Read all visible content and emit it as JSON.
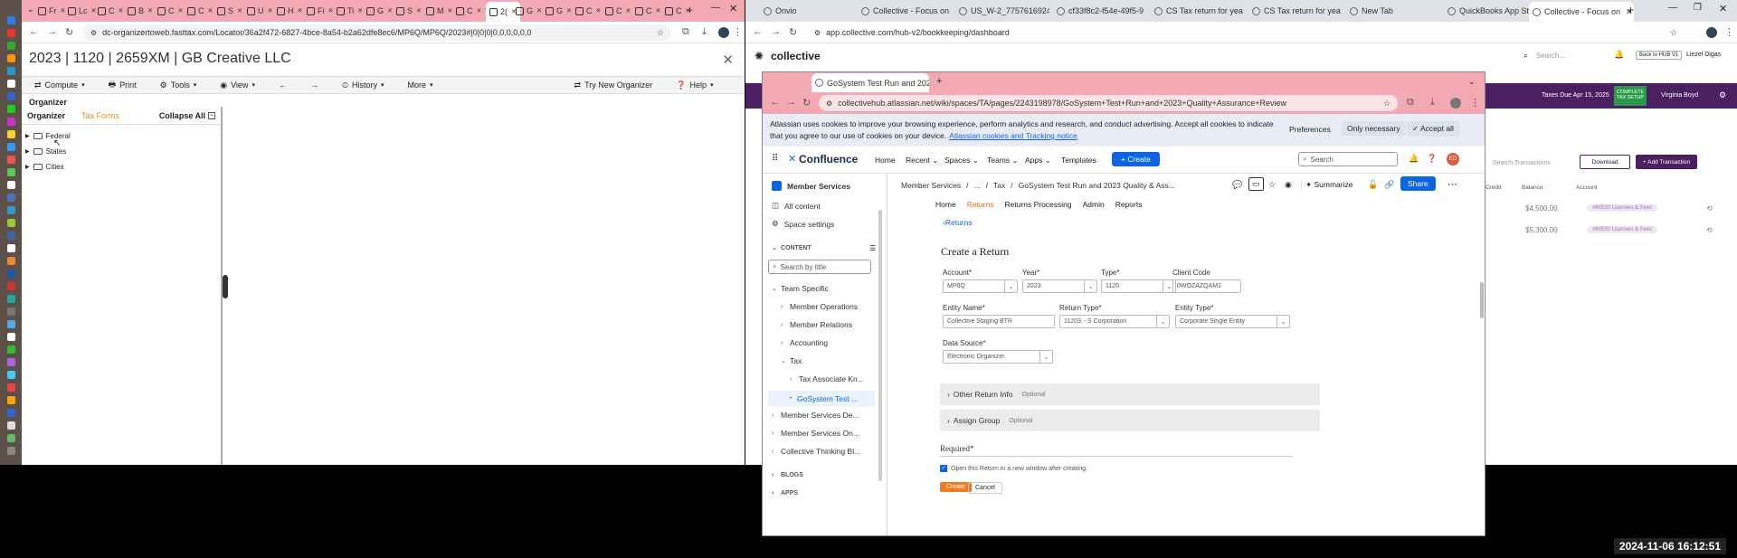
{
  "left_window": {
    "url": "dc-organizertoweb.fasttax.com/Locator/36a2f472-6827-4bce-8a54-b2a62dfe8ec6/MP6Q/MP6Q/2023#|0|0|0|0,0,0,0,0,0",
    "tab_labels": [
      "Fr",
      "Lc",
      "C",
      "B",
      "C",
      "C",
      "S",
      "U",
      "H",
      "Fi",
      "Ti",
      "G",
      "S",
      "M",
      "C",
      "2(",
      "G",
      "G",
      "C",
      "C",
      "C",
      "C"
    ],
    "organizer_title": "2023 | 1120 | 2659XM | GB Creative LLC",
    "close_glyph": "✕",
    "toolbar": {
      "compute": "Compute",
      "print": "Print",
      "tools": "Tools",
      "view": "View",
      "history": "History",
      "more": "More",
      "try_new": "Try New Organizer",
      "help": "Help"
    },
    "section_label": "Organizer",
    "pane_tab_organizer": "Organizer",
    "pane_tab_taxforms": "Tax Forms",
    "collapse_all": "Collapse All",
    "tree": [
      "Federal",
      "States",
      "Cities"
    ]
  },
  "right_window": {
    "tabs": [
      "Onvio",
      "Collective - Focus on",
      "US_W-2_7757616924",
      "cf33f8c2-f54e-49f5-9",
      "CS Tax return for yea",
      "CS Tax return for yea",
      "New Tab",
      "QuickBooks App Sto",
      "Collective - Focus on"
    ],
    "url": "app.collective.com/hub-v2/bookkeeping/dashboard",
    "logo_text": "collective",
    "search_placeholder": "Search...",
    "back_to_hub": "Back to HUB V1",
    "user_name": "Liezel Digas",
    "taxes_due": "Taxes Due Apr 15, 2025",
    "complete_tax_setup": "COMPLETE TAX SETUP",
    "user2": "Virginia Boyd",
    "search_tx_placeholder": "Search Transactions",
    "download": "Download",
    "add_transaction": "+ Add Transaction",
    "col_credit": "Credit",
    "col_balance": "Balance",
    "col_account": "Account",
    "rows": [
      {
        "balance": "$4,500.00",
        "account": "#60530 Licenses & Fees"
      },
      {
        "balance": "$5,300.00",
        "account": "#60530 Licenses & Fees"
      }
    ]
  },
  "popup": {
    "tab": "GoSystem Test Run and 2023",
    "url": "collectivehub.atlassian.net/wiki/spaces/TA/pages/2243198978/GoSystem+Test+Run+and+2023+Quality+Assurance+Review",
    "cookie_line1": "Atlassian uses cookies to improve your browsing experience, perform analytics and research, and conduct advertising. Accept all cookies to indicate",
    "cookie_line2": "that you agree to our use of cookies on your device.",
    "cookie_link": "Atlassian cookies and Tracking notice",
    "preferences": "Preferences",
    "only_necessary": "Only necessary",
    "accept_all": "Accept all",
    "nav": {
      "logo": "Confluence",
      "home": "Home",
      "recent": "Recent",
      "spaces": "Spaces",
      "teams": "Teams",
      "apps": "Apps",
      "templates": "Templates",
      "create": "+ Create",
      "search": "Search",
      "avatar": "ED"
    },
    "sidebar": {
      "space": "Member Services",
      "all_content": "All content",
      "space_settings": "Space settings",
      "content": "CONTENT",
      "search_placeholder": "Search by title",
      "items": [
        "Team Specific",
        "Member Operations",
        "Member Relations",
        "Accounting",
        "Tax",
        "Tax Associate Kn...",
        "GoSystem Test ...",
        "Member Services De...",
        "Member Services On...",
        "Collective Thinking Bl..."
      ],
      "blogs": "BLOGS",
      "apps": "APPS"
    },
    "breadcrumb": {
      "space": "Member Services",
      "sep1": "/",
      "ellipsis": "...",
      "sep2": "/",
      "tax": "Tax",
      "sep3": "/",
      "page": "GoSystem Test Run and 2023 Quality & Ass..."
    },
    "summarize": "Summarize",
    "share": "Share",
    "page_nav": {
      "home": "Home",
      "returns": "Returns",
      "returns_processing": "Returns Processing",
      "admin": "Admin",
      "reports": "Reports"
    },
    "back_returns": "Returns",
    "form": {
      "title": "Create a Return",
      "account_label": "Account*",
      "account": "MP6Q",
      "year_label": "Year*",
      "year": "2023",
      "type_label": "Type*",
      "type": "1120",
      "client_code_label": "Client Code",
      "client_code": "0WOZAZQAM1",
      "entity_name_label": "Entity Name*",
      "entity_name": "Collective Staging BTR",
      "return_type_label": "Return Type*",
      "return_type": "1120S - S Corporation",
      "entity_type_label": "Entity Type*",
      "entity_type": "Corporate Single Entity",
      "data_source_label": "Data Source*",
      "data_source": "Electronic Organizer",
      "other_info": "Other Return Info",
      "optional": "Optional",
      "assign_group": "Assign Group",
      "optional2": "Optional",
      "required": "Required*",
      "new_window": "Open this Return in a new window after creating.",
      "create": "Create",
      "cancel": "Cancel"
    }
  },
  "clock": "2024-11-06 16:12:51",
  "colors": {
    "pink": "#f3a9b4",
    "purple": "#4a2060",
    "confluence_blue": "#0c66e4",
    "orange": "#f07b1d"
  }
}
